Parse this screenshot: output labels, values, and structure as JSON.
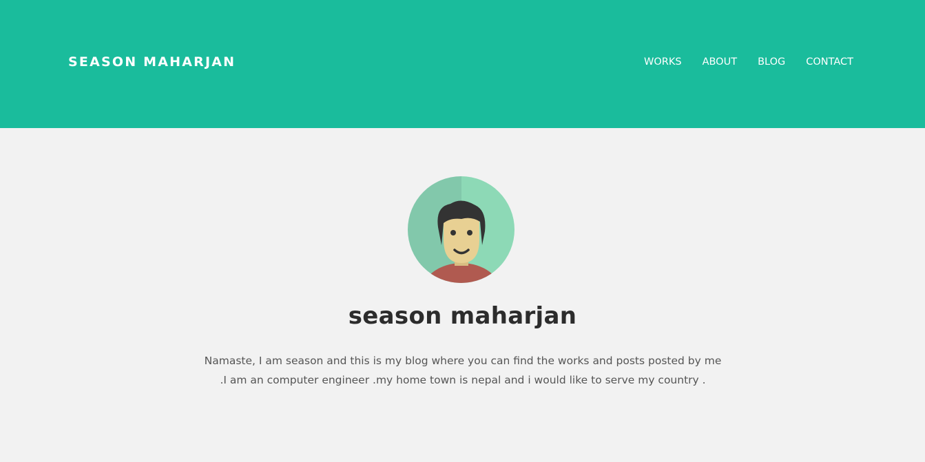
{
  "header": {
    "brand": "SEASON MAHARJAN",
    "nav": [
      {
        "label": "WORKS"
      },
      {
        "label": "ABOUT"
      },
      {
        "label": "BLOG"
      },
      {
        "label": "CONTACT"
      }
    ]
  },
  "profile": {
    "avatar_icon": "person-avatar-icon",
    "name": "season maharjan",
    "bio": "Namaste, I am season and this is my blog where you can find the works and posts posted by me .I am an computer engineer .my home town is nepal and i would like to serve my country ."
  },
  "colors": {
    "header_bg": "#1abc9c",
    "page_bg": "#f2f2f2",
    "avatar_left": "#82c8ab",
    "avatar_right": "#8dd9b6",
    "shirt": "#b05a50",
    "skin": "#e8d093",
    "hair": "#333333"
  }
}
